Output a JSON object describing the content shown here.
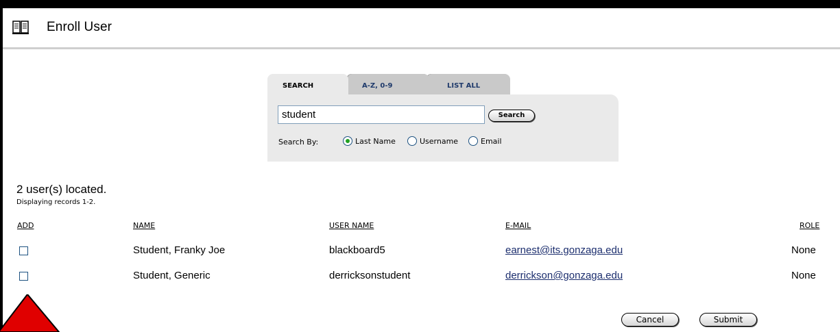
{
  "header": {
    "title": "Enroll User",
    "icon": "book-icon"
  },
  "search": {
    "tabs": [
      {
        "label": "SEARCH",
        "active": true
      },
      {
        "label": "A-Z, 0-9",
        "active": false
      },
      {
        "label": "LIST ALL",
        "active": false
      }
    ],
    "query": "student",
    "button_label": "Search",
    "search_by_label": "Search By:",
    "options": [
      {
        "label": "Last Name",
        "checked": true
      },
      {
        "label": "Username",
        "checked": false
      },
      {
        "label": "Email",
        "checked": false
      }
    ]
  },
  "results": {
    "count_text": "2 user(s) located.",
    "records_text": "Displaying records 1-2.",
    "columns": {
      "add": "ADD",
      "name": "NAME",
      "username": "USER NAME",
      "email": "E-MAIL",
      "role": "ROLE"
    },
    "rows": [
      {
        "checked": false,
        "name": "Student, Franky Joe",
        "username": "blackboard5",
        "email": "earnest@its.gonzaga.edu",
        "role": "None"
      },
      {
        "checked": false,
        "name": "Student, Generic",
        "username": "derricksonstudent",
        "email": "derrickson@gonzaga.edu",
        "role": "None"
      }
    ]
  },
  "actions": {
    "cancel_label": "Cancel",
    "submit_label": "Submit"
  },
  "colors": {
    "overlay_triangle": "#e00000",
    "link": "#1c2e6e",
    "radio_selected": "#21a121"
  }
}
